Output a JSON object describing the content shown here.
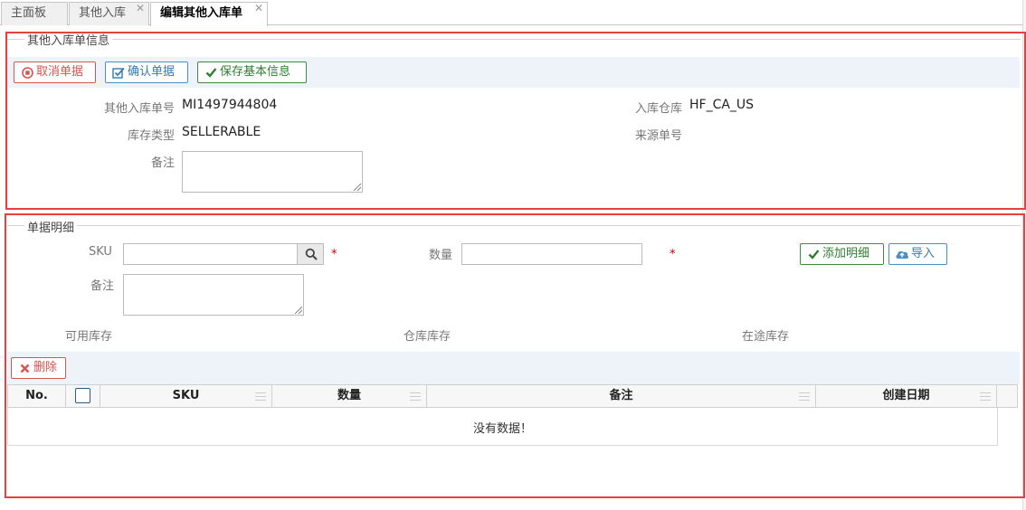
{
  "tabs": [
    {
      "label": "主面板",
      "closable": false,
      "active": false
    },
    {
      "label": "其他入库",
      "closable": true,
      "active": false
    },
    {
      "label": "编辑其他入库单",
      "closable": true,
      "active": true
    }
  ],
  "info": {
    "legend": "其他入库单信息",
    "buttons": {
      "cancel": "取消单据",
      "confirm": "确认单据",
      "save": "保存基本信息"
    },
    "fields": {
      "order_no_label": "其他入库单号",
      "order_no_value": "MI1497944804",
      "warehouse_label": "入库仓库",
      "warehouse_value": "HF_CA_US",
      "inventory_type_label": "库存类型",
      "inventory_type_value": "SELLERABLE",
      "source_no_label": "来源单号",
      "source_no_value": "",
      "remark_label": "备注",
      "remark_value": ""
    }
  },
  "detail": {
    "legend": "单据明细",
    "sku_label": "SKU",
    "sku_value": "",
    "sku_placeholder": "",
    "qty_label": "数量",
    "qty_value": "",
    "required_mark": "*",
    "remark_label": "备注",
    "remark_value": "",
    "add_button": "添加明细",
    "import_button": "导入",
    "available_stock_label": "可用库存",
    "warehouse_stock_label": "仓库库存",
    "in_transit_stock_label": "在途库存",
    "delete_button": "删除",
    "table": {
      "columns": [
        "No.",
        "",
        "SKU",
        "数量",
        "备注",
        "创建日期"
      ],
      "empty_text": "没有数据！"
    }
  },
  "colors": {
    "highlight": "#e8403f",
    "cancel": "#d9534f",
    "confirm": "#337ab7",
    "save": "#2e7d32"
  },
  "icons": {
    "cancel": "stop-circle-icon",
    "confirm": "check-square-icon",
    "save": "check-icon",
    "search": "search-icon",
    "add": "check-icon",
    "import": "cloud-upload-icon",
    "delete": "close-icon"
  }
}
